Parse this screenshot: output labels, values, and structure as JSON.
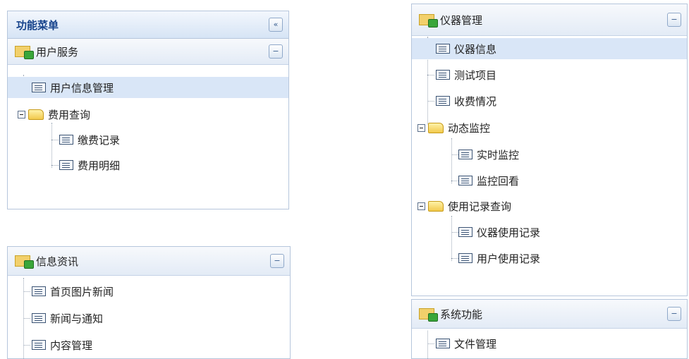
{
  "left_panel": {
    "title": "功能菜单",
    "collapse_btn": "«",
    "group": {
      "title": "用户服务",
      "toggle": "−",
      "items": [
        "用户信息管理"
      ],
      "folder": {
        "label": "费用查询",
        "children": [
          "缴费记录",
          "费用明细"
        ]
      }
    }
  },
  "info_panel": {
    "title": "信息资讯",
    "toggle": "−",
    "items": [
      "首页图片新闻",
      "新闻与通知",
      "内容管理"
    ]
  },
  "instrument_panel": {
    "title": "仪器管理",
    "toggle": "−",
    "items": [
      "仪器信息",
      "测试项目",
      "收费情况"
    ],
    "folders": [
      {
        "label": "动态监控",
        "children": [
          "实时监控",
          "监控回看"
        ]
      },
      {
        "label": "使用记录查询",
        "children": [
          "仪器使用记录",
          "用户使用记录"
        ]
      }
    ]
  },
  "system_panel": {
    "title": "系统功能",
    "toggle": "−",
    "items": [
      "文件管理"
    ]
  }
}
